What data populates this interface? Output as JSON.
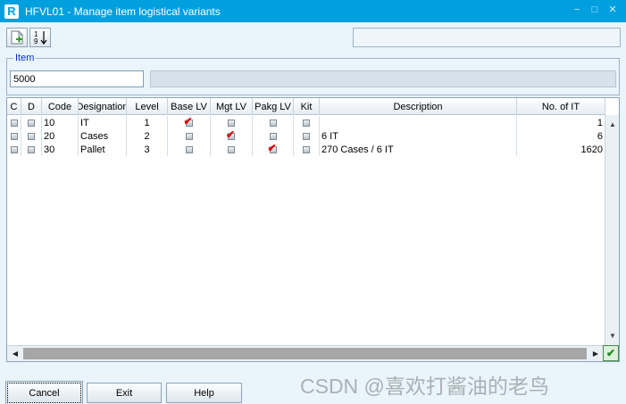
{
  "window": {
    "title": "HFVL01 - Manage item logistical variants",
    "logo_letter": "R",
    "controls": [
      "−",
      "□",
      "✕"
    ]
  },
  "toolbar": {
    "new_icon": "new-document-icon",
    "sort_icon": "sort-ascending-icon",
    "sort_label_top": "1",
    "sort_label_bottom": "9"
  },
  "item": {
    "legend": "Item",
    "value": "5000"
  },
  "grid": {
    "columns": [
      "C",
      "D",
      "Code",
      "Designation",
      "Level",
      "Base LV",
      "Mgt LV",
      "Pakg LV",
      "Kit",
      "Description",
      "No. of IT"
    ],
    "rows": [
      {
        "code": "10",
        "designation": "IT",
        "level": "1",
        "base_lv": true,
        "mgt_lv": false,
        "pakg_lv": false,
        "kit": false,
        "description": "",
        "no_of_it": "1"
      },
      {
        "code": "20",
        "designation": "Cases",
        "level": "2",
        "base_lv": false,
        "mgt_lv": true,
        "pakg_lv": false,
        "kit": false,
        "description": "6 IT",
        "no_of_it": "6"
      },
      {
        "code": "30",
        "designation": "Pallet",
        "level": "3",
        "base_lv": false,
        "mgt_lv": false,
        "pakg_lv": true,
        "kit": false,
        "description": "270 Cases / 6 IT",
        "no_of_it": "1620"
      }
    ]
  },
  "buttons": {
    "cancel": "Cancel",
    "exit": "Exit",
    "help": "Help"
  },
  "watermark": "CSDN @喜欢打酱油的老鸟",
  "colors": {
    "titlebar": "#00a0df",
    "background": "#e9f4fb",
    "checkmark": "#e00000",
    "legend": "#0033cc"
  }
}
